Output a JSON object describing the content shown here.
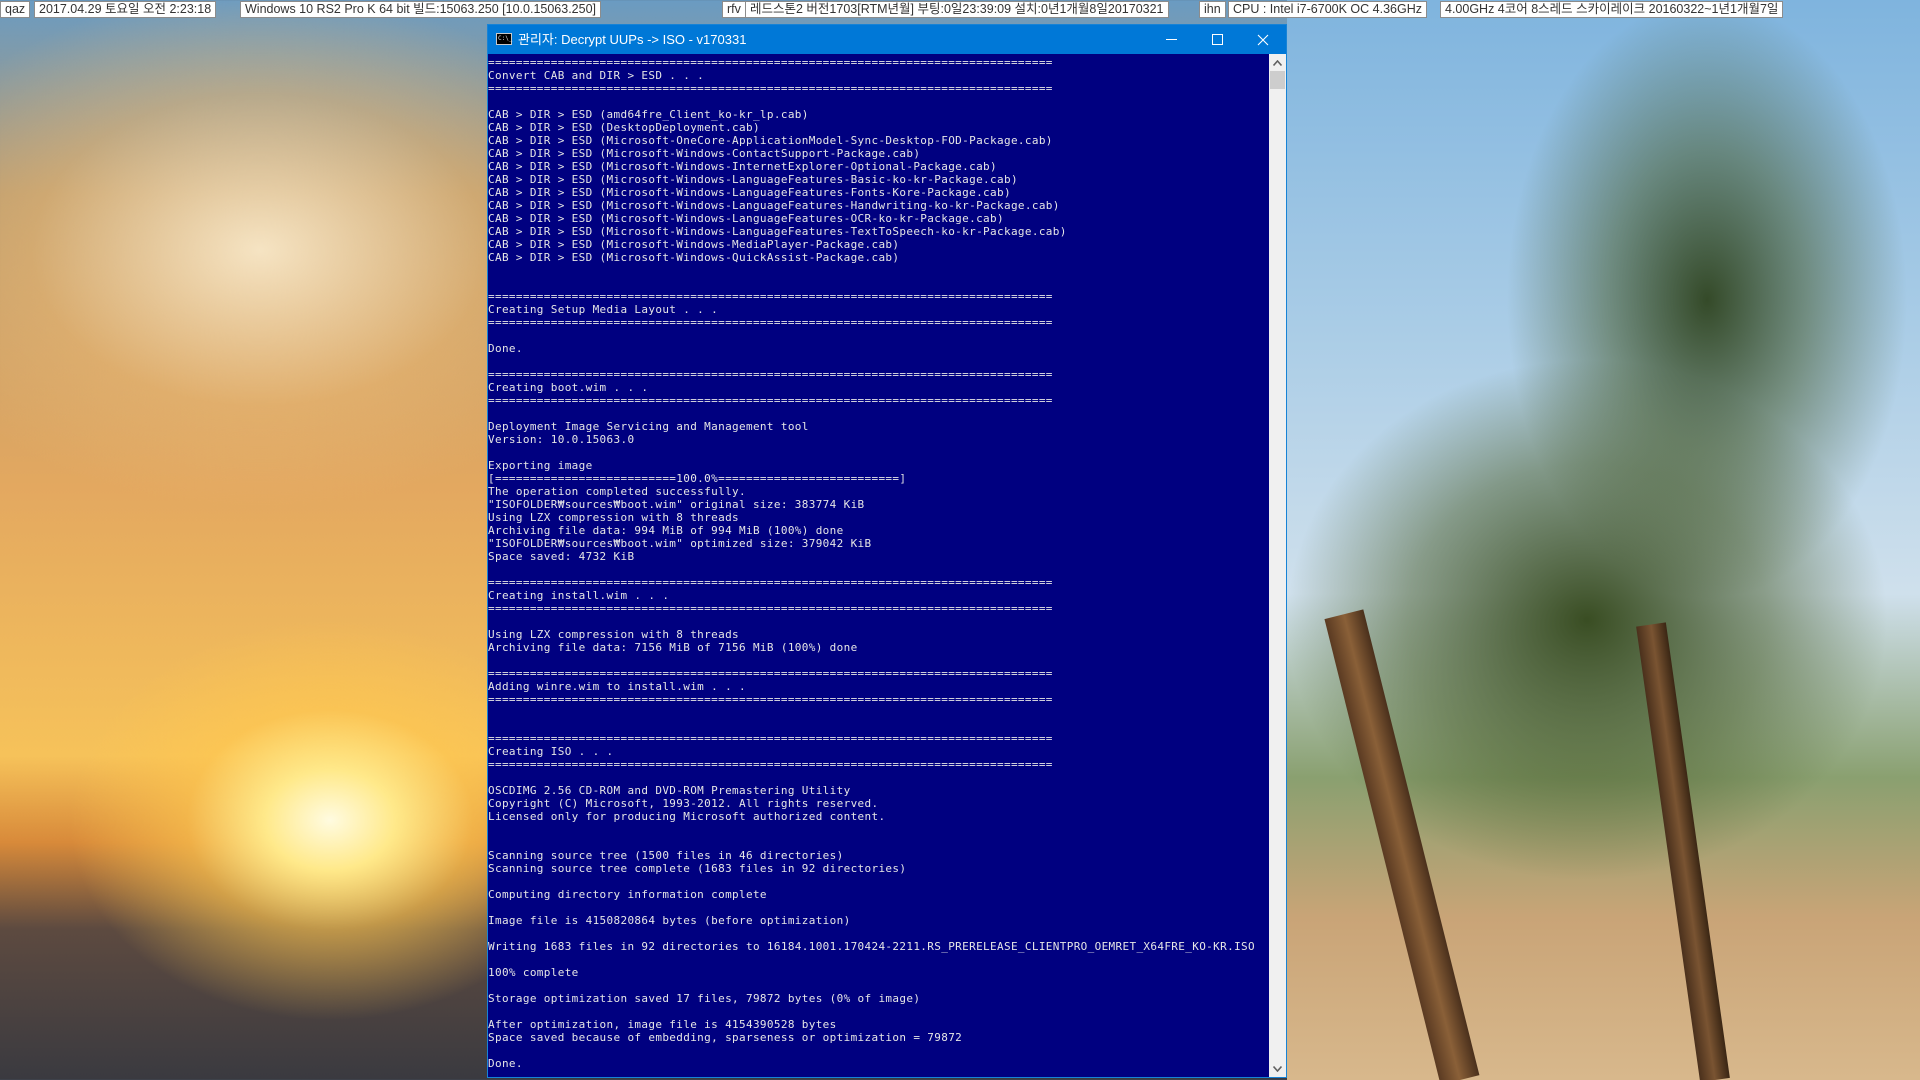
{
  "topbar": {
    "items": [
      {
        "label": "qaz"
      },
      {
        "label": "2017.04.29 토요일  오전 2:23:18"
      },
      {
        "label": "Windows 10 RS2 Pro K 64 bit 빌드:15063.250 [10.0.15063.250]"
      },
      {
        "label": "rfv"
      },
      {
        "label": "레드스톤2 버전1703[RTM년월] 부팅:0일23:39:09 설치:0년1개월8일20170321"
      },
      {
        "label": "ihn"
      },
      {
        "label": "CPU : Intel i7-6700K OC 4.36GHz"
      },
      {
        "label": "4.00GHz 4코어 8스레드 스카이레이크 20160322~1년1개월7일"
      }
    ]
  },
  "window": {
    "title": "관리자:  Decrypt UUPs -> ISO - v170331",
    "icon": "cmd-icon",
    "controls": {
      "minimize": "minimize-icon",
      "maximize": "maximize-icon",
      "close": "close-icon"
    },
    "colors": {
      "titlebar": "#0078d7",
      "console_bg": "#000080",
      "console_text": "#e6e6e6"
    }
  },
  "console": {
    "lines": [
      "=================================================================================",
      "Convert CAB and DIR > ESD . . .",
      "=================================================================================",
      "",
      "CAB > DIR > ESD (amd64fre_Client_ko-kr_lp.cab)",
      "CAB > DIR > ESD (DesktopDeployment.cab)",
      "CAB > DIR > ESD (Microsoft-OneCore-ApplicationModel-Sync-Desktop-FOD-Package.cab)",
      "CAB > DIR > ESD (Microsoft-Windows-ContactSupport-Package.cab)",
      "CAB > DIR > ESD (Microsoft-Windows-InternetExplorer-Optional-Package.cab)",
      "CAB > DIR > ESD (Microsoft-Windows-LanguageFeatures-Basic-ko-kr-Package.cab)",
      "CAB > DIR > ESD (Microsoft-Windows-LanguageFeatures-Fonts-Kore-Package.cab)",
      "CAB > DIR > ESD (Microsoft-Windows-LanguageFeatures-Handwriting-ko-kr-Package.cab)",
      "CAB > DIR > ESD (Microsoft-Windows-LanguageFeatures-OCR-ko-kr-Package.cab)",
      "CAB > DIR > ESD (Microsoft-Windows-LanguageFeatures-TextToSpeech-ko-kr-Package.cab)",
      "CAB > DIR > ESD (Microsoft-Windows-MediaPlayer-Package.cab)",
      "CAB > DIR > ESD (Microsoft-Windows-QuickAssist-Package.cab)",
      "",
      "",
      "=================================================================================",
      "Creating Setup Media Layout . . .",
      "=================================================================================",
      "",
      "Done.",
      "",
      "=================================================================================",
      "Creating boot.wim . . .",
      "=================================================================================",
      "",
      "Deployment Image Servicing and Management tool",
      "Version: 10.0.15063.0",
      "",
      "Exporting image",
      "[==========================100.0%==========================]",
      "The operation completed successfully.",
      "\"ISOFOLDER₩sources₩boot.wim\" original size: 383774 KiB",
      "Using LZX compression with 8 threads",
      "Archiving file data: 994 MiB of 994 MiB (100%) done",
      "\"ISOFOLDER₩sources₩boot.wim\" optimized size: 379042 KiB",
      "Space saved: 4732 KiB",
      "",
      "=================================================================================",
      "Creating install.wim . . .",
      "=================================================================================",
      "",
      "Using LZX compression with 8 threads",
      "Archiving file data: 7156 MiB of 7156 MiB (100%) done",
      "",
      "=================================================================================",
      "Adding winre.wim to install.wim . . .",
      "=================================================================================",
      "",
      "",
      "=================================================================================",
      "Creating ISO . . .",
      "=================================================================================",
      "",
      "OSCDIMG 2.56 CD-ROM and DVD-ROM Premastering Utility",
      "Copyright (C) Microsoft, 1993-2012. All rights reserved.",
      "Licensed only for producing Microsoft authorized content.",
      "",
      "",
      "Scanning source tree (1500 files in 46 directories)",
      "Scanning source tree complete (1683 files in 92 directories)",
      "",
      "Computing directory information complete",
      "",
      "Image file is 4150820864 bytes (before optimization)",
      "",
      "Writing 1683 files in 92 directories to 16184.1001.170424-2211.RS_PRERELEASE_CLIENTPRO_OEMRET_X64FRE_KO-KR.ISO",
      "",
      "100% complete",
      "",
      "Storage optimization saved 17 files, 79872 bytes (0% of image)",
      "",
      "After optimization, image file is 4154390528 bytes",
      "Space saved because of embedding, sparseness or optimization = 79872",
      "",
      "Done."
    ],
    "export_progress_percent": 100.0
  },
  "scrollbar": {
    "up": "chevron-up-icon",
    "down": "chevron-down-icon",
    "up_glyph": "⌃",
    "down_glyph": "⌄"
  }
}
